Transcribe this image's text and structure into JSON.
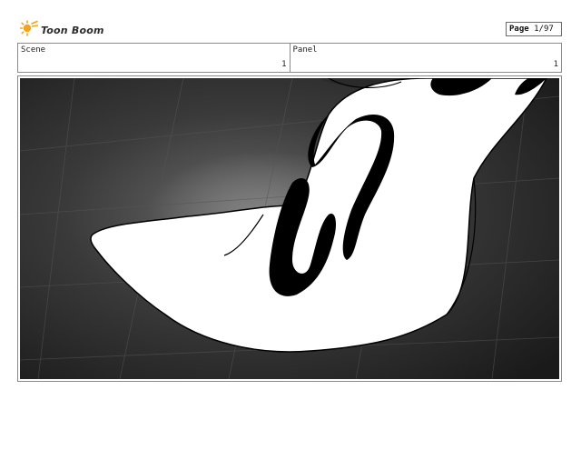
{
  "header": {
    "logo_text": "Toon Boom",
    "logo_icon": "toon-boom-logo-icon",
    "page_label": "Page",
    "page_value": "1/97"
  },
  "info": {
    "scene_label": "Scene",
    "scene_value": "1",
    "panel_label": "Panel",
    "panel_value": "1"
  },
  "panel_image": {
    "description_icon": "storyboard-drawing",
    "colors": {
      "background_dark": "#1f1f1f",
      "background_mid": "#5a5a5a",
      "ink": "#000000",
      "paper": "#ffffff"
    }
  }
}
